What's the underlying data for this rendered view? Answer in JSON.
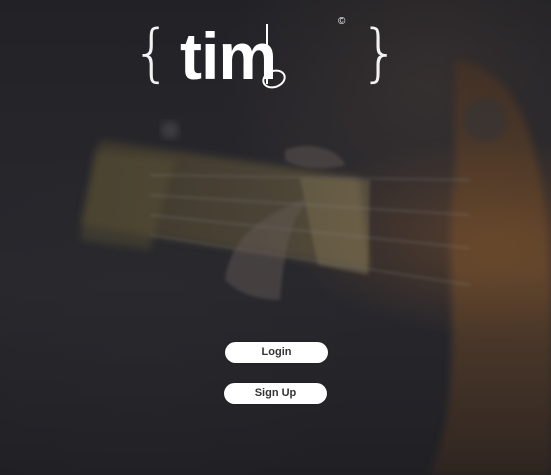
{
  "brand": {
    "brace_open": "{",
    "brace_close": "}",
    "wordmark": "tim",
    "copyright_symbol": "©"
  },
  "actions": {
    "login_label": "Login",
    "signup_label": "Sign Up"
  },
  "colors": {
    "button_bg": "#ffffff",
    "button_text": "#333333",
    "logo": "#ffffff"
  }
}
